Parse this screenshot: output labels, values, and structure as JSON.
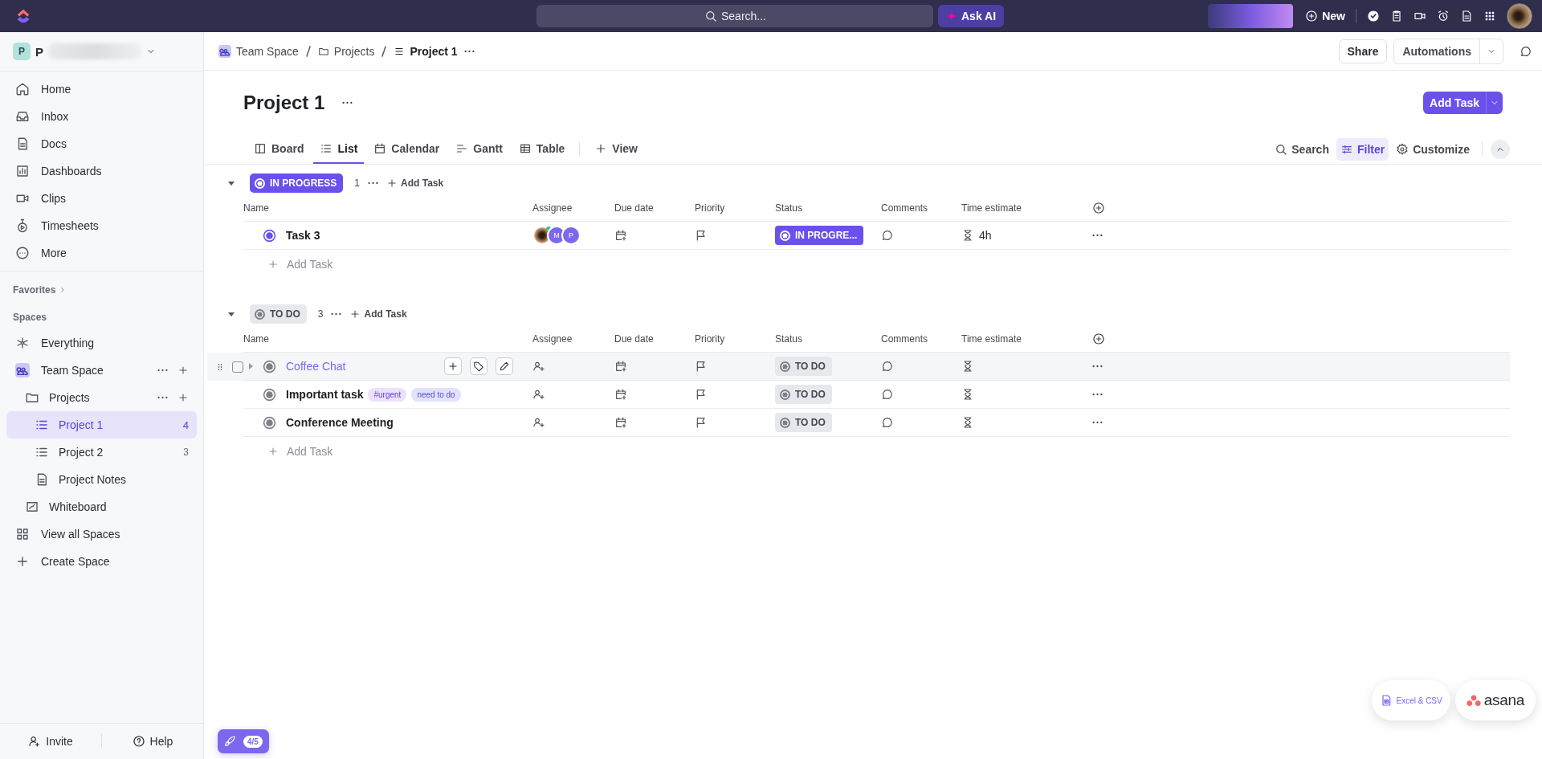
{
  "topbar": {
    "search_placeholder": "Search...",
    "ask_ai": "Ask AI",
    "new": "New"
  },
  "workspace": {
    "initial": "P",
    "name": "P"
  },
  "nav": [
    {
      "label": "Home",
      "selected": false
    },
    {
      "label": "Inbox",
      "selected": false
    },
    {
      "label": "Docs",
      "selected": false
    },
    {
      "label": "Dashboards",
      "selected": false
    },
    {
      "label": "Clips",
      "selected": false
    },
    {
      "label": "Timesheets",
      "selected": false
    },
    {
      "label": "More",
      "selected": false
    }
  ],
  "favorites": "Favorites",
  "spaces_heading": "Spaces",
  "spaces": [
    {
      "label": "Everything",
      "kind": "everything",
      "selected": false
    },
    {
      "label": "Team Space",
      "kind": "space",
      "selected": false,
      "actions": true,
      "children": [
        {
          "label": "Projects",
          "kind": "folder",
          "selected": false,
          "actions": true,
          "children": [
            {
              "label": "Project 1",
              "kind": "list",
              "selected": true,
              "count": "4"
            },
            {
              "label": "Project 2",
              "kind": "list",
              "selected": false,
              "count": "3"
            },
            {
              "label": "Project Notes",
              "kind": "doc",
              "selected": false
            }
          ]
        },
        {
          "label": "Whiteboard",
          "kind": "whiteboard",
          "selected": false
        }
      ]
    },
    {
      "label": "View all Spaces",
      "kind": "grid",
      "selected": false
    },
    {
      "label": "Create Space",
      "kind": "add",
      "selected": false
    }
  ],
  "footer": {
    "invite": "Invite",
    "help": "Help"
  },
  "breadcrumb": [
    "Team Space",
    "Projects",
    "Project 1"
  ],
  "header_buttons": {
    "share": "Share",
    "automations": "Automations"
  },
  "title": "Project 1",
  "add_task": "Add Task",
  "views": [
    {
      "label": "Board",
      "selected": false
    },
    {
      "label": "List",
      "selected": true
    },
    {
      "label": "Calendar",
      "selected": false
    },
    {
      "label": "Gantt",
      "selected": false
    },
    {
      "label": "Table",
      "selected": false
    }
  ],
  "add_view": "View",
  "tools": [
    {
      "label": "Search",
      "selected": false
    },
    {
      "label": "Filter",
      "selected": true
    },
    {
      "label": "Customize",
      "selected": false
    }
  ],
  "groups": [
    {
      "status": "IN PROGRESS",
      "kind": "in_progress",
      "count": "1",
      "add": "Add Task",
      "add_row": "Add Task",
      "columns": [
        "Name",
        "Assignee",
        "Due date",
        "Priority",
        "Status",
        "Comments",
        "Time estimate"
      ],
      "tasks": [
        {
          "name": "Task 3",
          "hovered": false,
          "assignees": [
            {
              "kind": "photo"
            },
            {
              "kind": "initial",
              "initial": "M"
            },
            {
              "kind": "initial",
              "initial": "P"
            }
          ],
          "status": "IN PROGRE...",
          "time": "4h"
        }
      ]
    },
    {
      "status": "TO DO",
      "kind": "todo",
      "count": "3",
      "add": "Add Task",
      "add_row": "Add Task",
      "columns": [
        "Name",
        "Assignee",
        "Due date",
        "Priority",
        "Status",
        "Comments",
        "Time estimate"
      ],
      "tasks": [
        {
          "name": "Coffee Chat",
          "hovered": true,
          "status": "TO DO"
        },
        {
          "name": "Important task",
          "hovered": false,
          "tags": [
            {
              "label": "#urgent",
              "color": "#ece1fb"
            },
            {
              "label": "need to do",
              "color": "#dfe3fb"
            }
          ],
          "status": "TO DO"
        },
        {
          "name": "Conference Meeting",
          "hovered": false,
          "status": "TO DO"
        }
      ]
    }
  ],
  "import": {
    "excel": "Excel & CSV",
    "asana": "asana"
  },
  "onboarding": "4/5"
}
